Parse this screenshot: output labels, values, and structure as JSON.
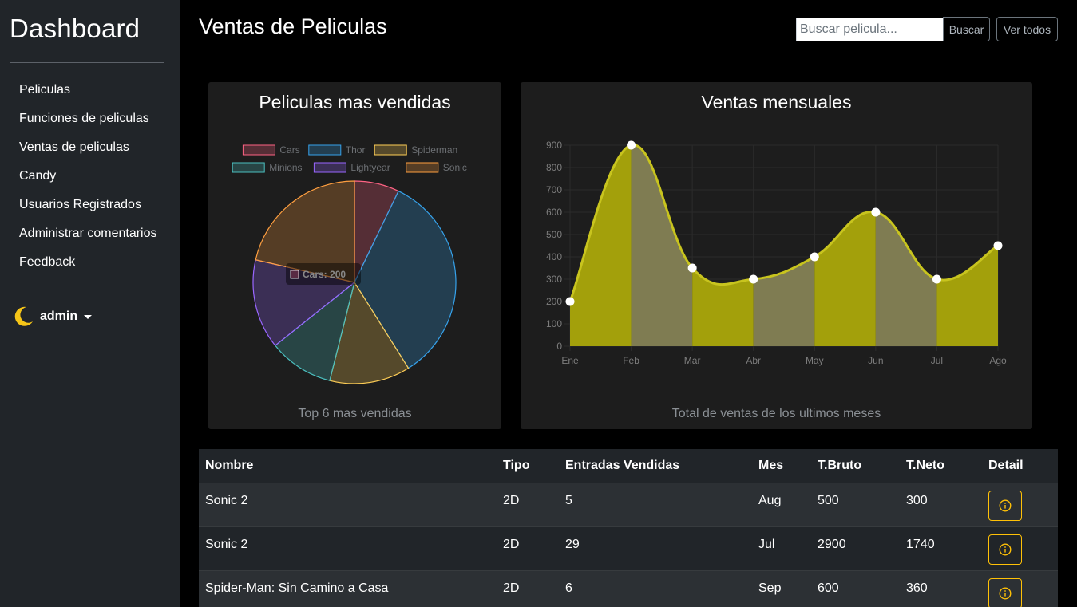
{
  "sidebar": {
    "brand": "Dashboard",
    "items": [
      {
        "label": "Peliculas"
      },
      {
        "label": "Funciones de peliculas"
      },
      {
        "label": "Ventas de peliculas"
      },
      {
        "label": "Candy"
      },
      {
        "label": "Usuarios Registrados"
      },
      {
        "label": "Administrar comentarios"
      },
      {
        "label": "Feedback"
      }
    ],
    "user": {
      "name": "admin",
      "icon": "moon-icon",
      "icon_color": "#f5c518"
    }
  },
  "header": {
    "title": "Ventas de Peliculas",
    "search_placeholder": "Buscar pelicula...",
    "search_value": "",
    "search_button": "Buscar",
    "view_all_button": "Ver todos"
  },
  "pie_card": {
    "title": "Peliculas mas vendidas",
    "footer": "Top 6 mas vendidas",
    "tooltip": "Cars: 200"
  },
  "line_card": {
    "title": "Ventas mensuales",
    "footer": "Total de ventas de los ultimos meses"
  },
  "chart_data": [
    {
      "type": "pie",
      "labels": [
        "Cars",
        "Thor",
        "Spiderman",
        "Minions",
        "Lightyear",
        "Sonic"
      ],
      "values": [
        200,
        950,
        360,
        290,
        400,
        600
      ],
      "colors": [
        "#ff6384",
        "#36a2eb",
        "#ffce56",
        "#4bc0c0",
        "#9966ff",
        "#ff9f40"
      ],
      "legend": "top"
    },
    {
      "type": "area",
      "categories": [
        "Ene",
        "Feb",
        "Mar",
        "Abr",
        "May",
        "Jun",
        "Jul",
        "Ago"
      ],
      "values": [
        200,
        900,
        350,
        300,
        400,
        600,
        300,
        450
      ],
      "ylim": [
        0,
        900
      ],
      "yticks": [
        0,
        100,
        200,
        300,
        400,
        500,
        600,
        700,
        800,
        900
      ],
      "fill_colors": [
        "#a3a00b",
        "#7f7c52"
      ],
      "line_color": "#c8c41e",
      "grid": true
    }
  ],
  "table": {
    "headers": [
      "Nombre",
      "Tipo",
      "Entradas Vendidas",
      "Mes",
      "T.Bruto",
      "T.Neto",
      "Detail"
    ],
    "rows": [
      [
        "Sonic 2",
        "2D",
        "5",
        "Aug",
        "500",
        "300"
      ],
      [
        "Sonic 2",
        "2D",
        "29",
        "Jul",
        "2900",
        "1740"
      ],
      [
        "Spider-Man: Sin Camino a Casa",
        "2D",
        "6",
        "Sep",
        "600",
        "360"
      ]
    ],
    "detail_icon": "info-icon",
    "accent": "#ffc107"
  }
}
